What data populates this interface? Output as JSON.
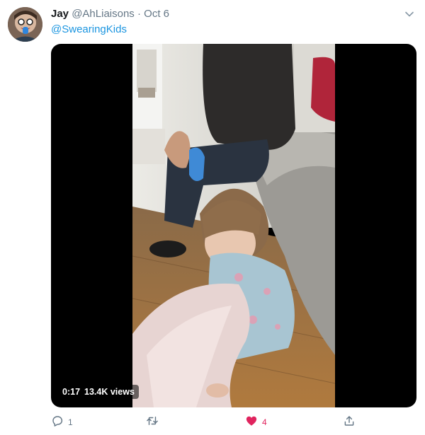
{
  "tweet": {
    "author": {
      "display_name": "Jay",
      "handle": "@AhLiaisons",
      "separator": "·",
      "date": "Oct 6"
    },
    "text": "@SwearingKids",
    "media": {
      "elapsed": "0:17",
      "views": "13.4K views"
    },
    "actions": {
      "reply_count": "1",
      "retweet_count": "",
      "like_count": "4",
      "liked": true
    }
  },
  "colors": {
    "link": "#1b95e0",
    "secondary_text": "#657786",
    "like": "#e0245e",
    "media_background": "#000000"
  },
  "icons": [
    "more-chevron-icon",
    "reply-icon",
    "retweet-icon",
    "heart-icon",
    "share-icon"
  ]
}
